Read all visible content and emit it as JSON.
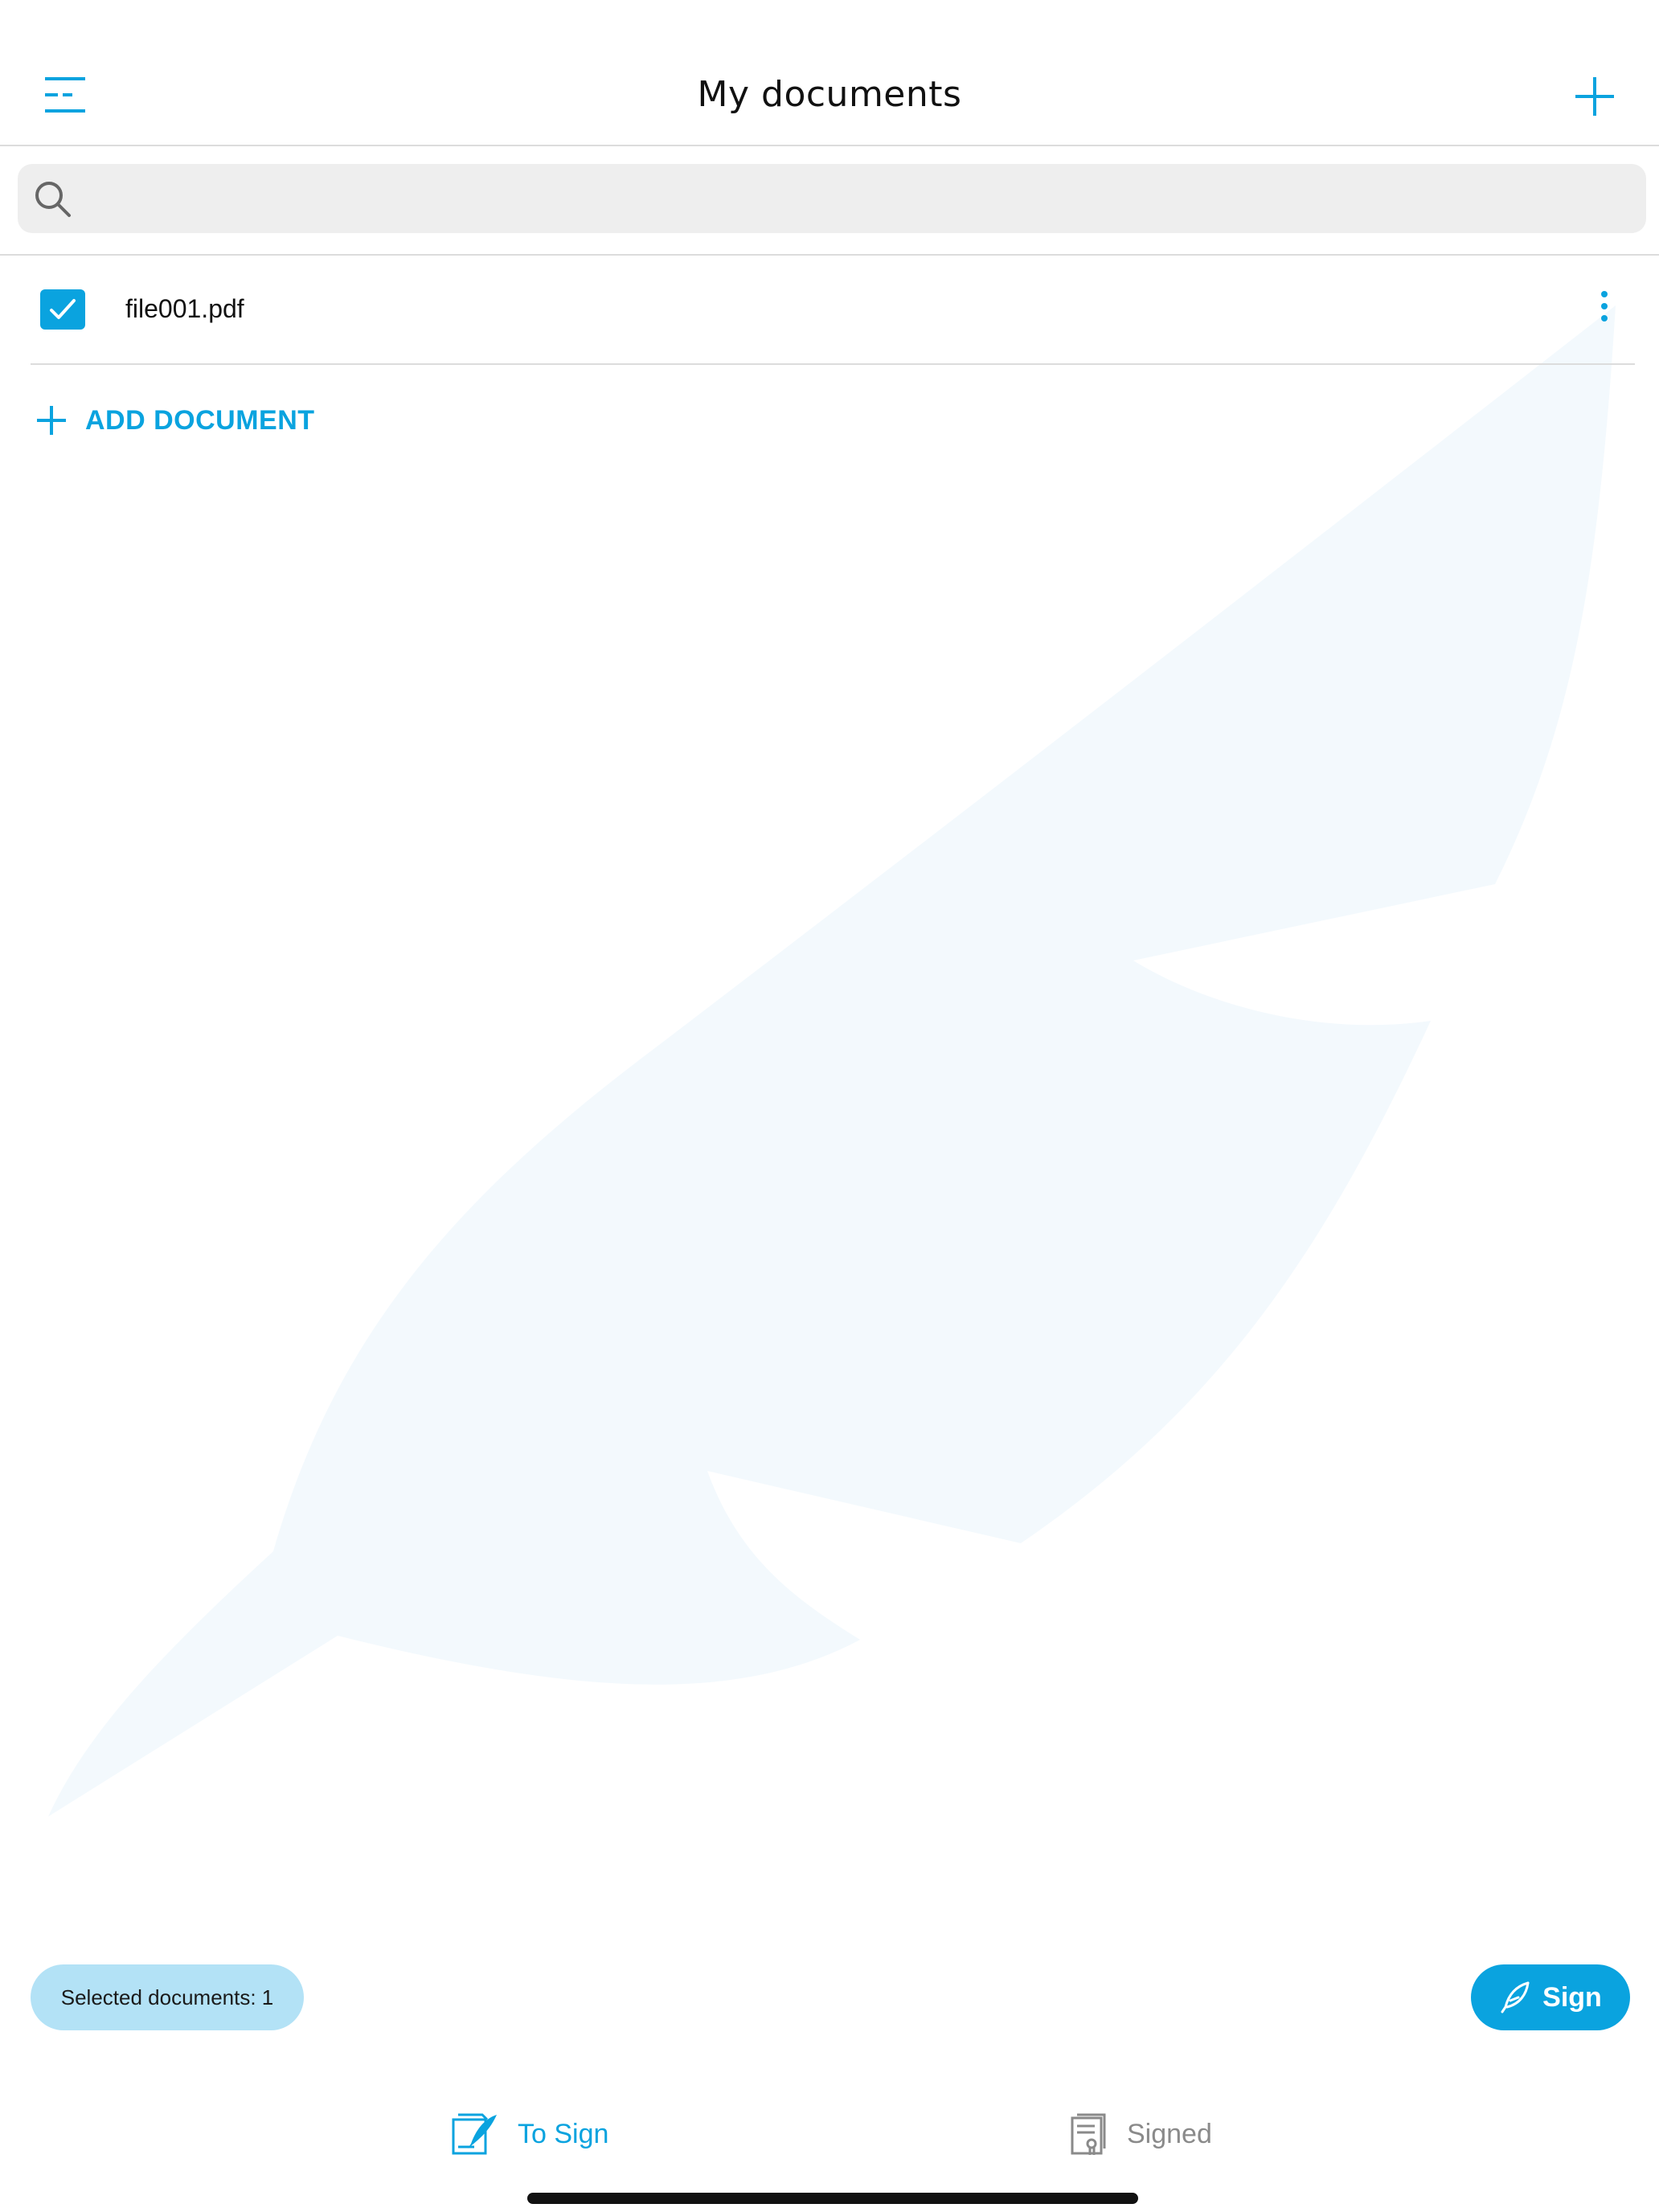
{
  "header": {
    "title": "My documents",
    "menu_icon": "menu-icon",
    "add_icon": "plus-icon"
  },
  "search": {
    "placeholder": "",
    "value": "",
    "icon": "search-icon"
  },
  "documents": [
    {
      "name": "file001.pdf",
      "checked": true
    }
  ],
  "add_document": {
    "label": "ADD DOCUMENT"
  },
  "footer": {
    "selected_label": "Selected documents: 1",
    "sign_label": "Sign"
  },
  "tabs": [
    {
      "label": "To Sign",
      "active": true,
      "icon": "to-sign-icon"
    },
    {
      "label": "Signed",
      "active": false,
      "icon": "signed-icon"
    }
  ],
  "colors": {
    "accent": "#0aa3df",
    "pill": "#b3e2f6",
    "watermark": "#f3f9fd",
    "inactive_tab": "#8a8a8a"
  }
}
